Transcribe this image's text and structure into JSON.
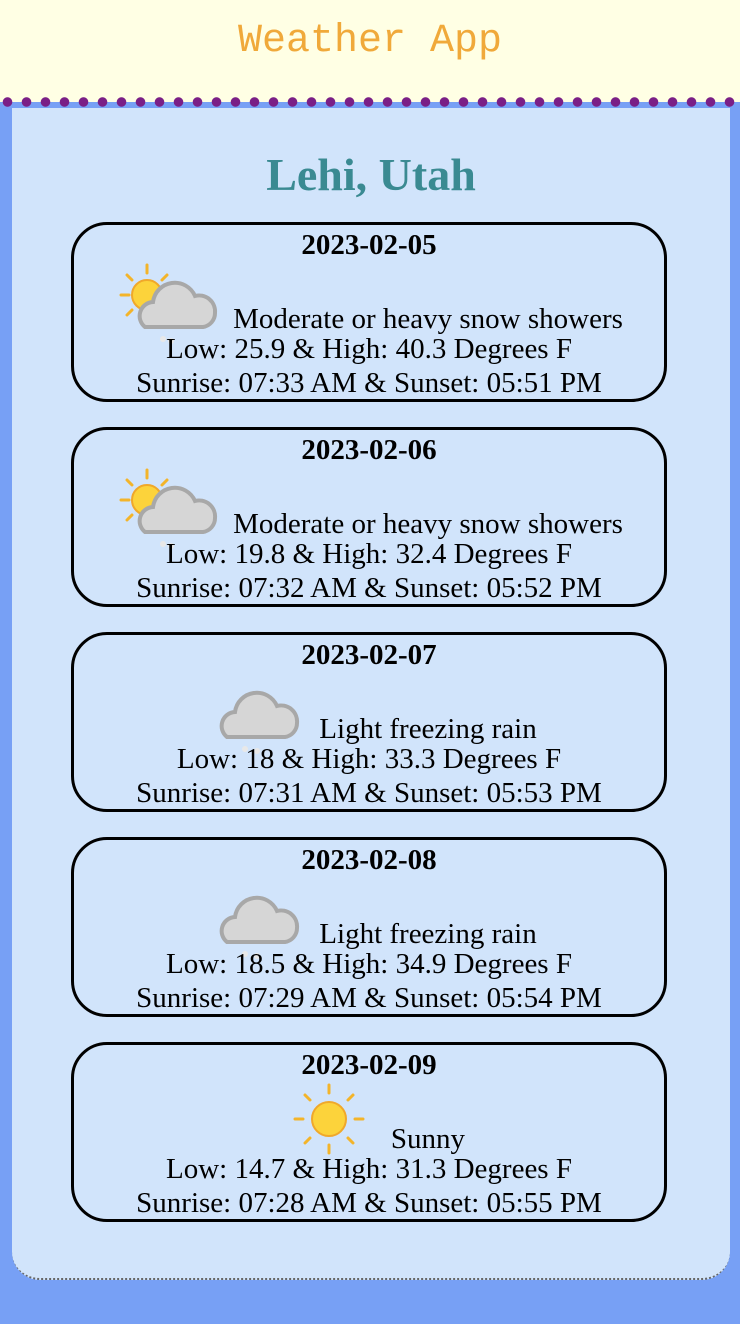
{
  "app": {
    "title": "Weather App"
  },
  "location": {
    "name": "Lehi, Utah"
  },
  "forecast": [
    {
      "date": "2023-02-05",
      "icon": "partly-cloudy-snow-icon",
      "condition": "Moderate or heavy snow showers",
      "temps": "Low: 25.9 & High: 40.3 Degrees F",
      "sun": "Sunrise: 07:33 AM & Sunset: 05:51 PM"
    },
    {
      "date": "2023-02-06",
      "icon": "partly-cloudy-snow-icon",
      "condition": "Moderate or heavy snow showers",
      "temps": "Low: 19.8 & High: 32.4 Degrees F",
      "sun": "Sunrise: 07:32 AM & Sunset: 05:52 PM"
    },
    {
      "date": "2023-02-07",
      "icon": "cloud-freezing-rain-icon",
      "condition": "Light freezing rain",
      "temps": "Low: 18 & High: 33.3 Degrees F",
      "sun": "Sunrise: 07:31 AM & Sunset: 05:53 PM"
    },
    {
      "date": "2023-02-08",
      "icon": "cloud-freezing-rain-icon",
      "condition": "Light freezing rain",
      "temps": "Low: 18.5 & High: 34.9 Degrees F",
      "sun": "Sunrise: 07:29 AM & Sunset: 05:54 PM"
    },
    {
      "date": "2023-02-09",
      "icon": "sun-icon",
      "condition": "Sunny",
      "temps": "Low: 14.7 & High: 31.3 Degrees F",
      "sun": "Sunrise: 07:28 AM & Sunset: 05:55 PM"
    }
  ],
  "colors": {
    "header_bg": "#ffffe4",
    "title": "#f0a93a",
    "dots": "#7a1f86",
    "panel_bg": "#d1e4fb",
    "page_bg": "#77a0f5",
    "city": "#3a8a92"
  }
}
